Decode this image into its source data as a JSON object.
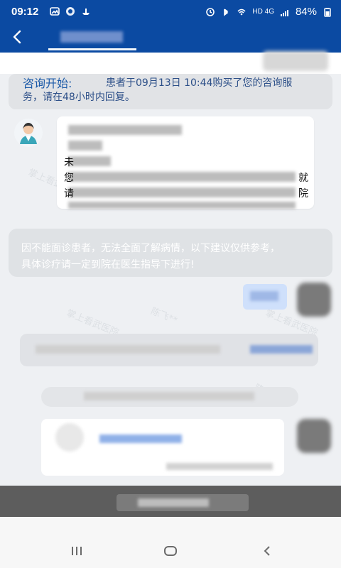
{
  "status": {
    "time": "09:12",
    "battery": "84%",
    "network": "HD 4G",
    "icons": [
      "image-icon",
      "color-icon",
      "ship-icon",
      "alarm-icon",
      "bluetooth-icon",
      "wifi-icon",
      "signal-icon",
      "battery-icon"
    ]
  },
  "header": {
    "back_icon": "back-arrow-icon"
  },
  "consult": {
    "heading": "咨询开始:",
    "line1": "患者于09月13日 10:44购买了您的咨询服",
    "line2": "务，请在48小时内回复。"
  },
  "doctor_message": {
    "avatar_icon": "doctor-avatar-icon",
    "fragments": {
      "c1": "就",
      "c2": "院",
      "l1": "请",
      "l2": "您",
      "l3": "未"
    }
  },
  "notice": {
    "line1": "因不能面诊患者，无法全面了解病情，以下建议仅供参考，",
    "line2": "具体诊疗请一定到院在医生指导下进行!"
  },
  "watermarks": {
    "w1": "掌上看武医院",
    "w2": "陈飞**",
    "w3": "掌上看武医院",
    "w4": "陈飞**",
    "w5": "掌上看武医院"
  },
  "colors": {
    "primary": "#0b4aa2",
    "accent": "#1b5aa8",
    "bubble": "#cfe0fb",
    "notice": "#dfe2e5"
  }
}
